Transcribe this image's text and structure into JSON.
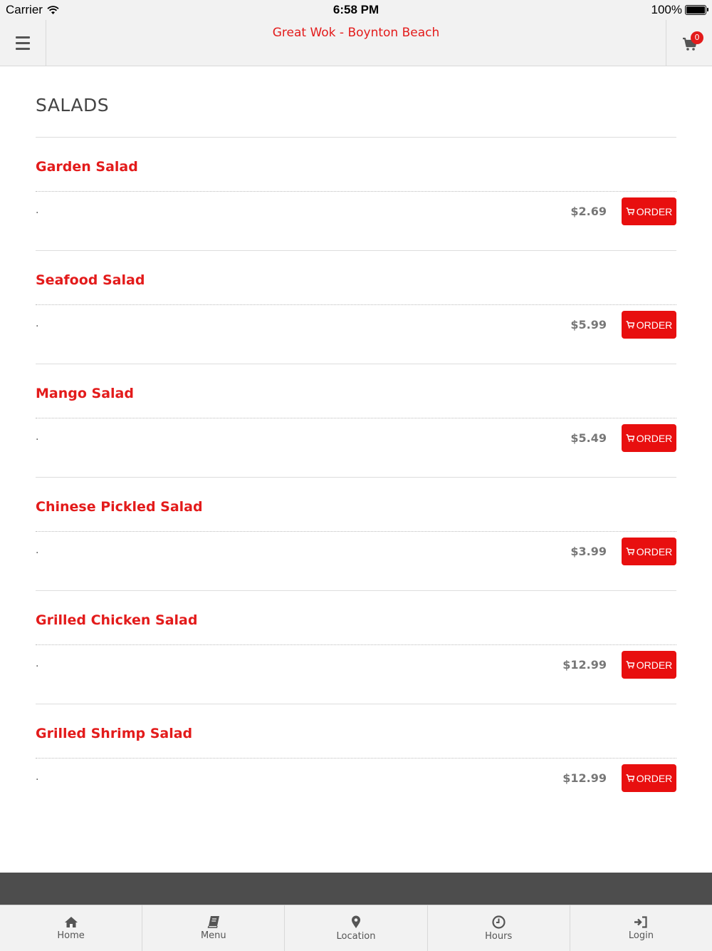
{
  "status_bar": {
    "carrier": "Carrier",
    "time": "6:58 PM",
    "battery": "100%"
  },
  "header": {
    "title": "Great Wok - Boynton Beach",
    "cart_count": "0"
  },
  "section": {
    "title": "SALADS"
  },
  "items": [
    {
      "name": "Garden Salad",
      "description": ".",
      "price": "$2.69",
      "order_label": "ORDER"
    },
    {
      "name": "Seafood Salad",
      "description": ".",
      "price": "$5.99",
      "order_label": "ORDER"
    },
    {
      "name": "Mango Salad",
      "description": ".",
      "price": "$5.49",
      "order_label": "ORDER"
    },
    {
      "name": "Chinese Pickled Salad",
      "description": ".",
      "price": "$3.99",
      "order_label": "ORDER"
    },
    {
      "name": "Grilled Chicken Salad",
      "description": ".",
      "price": "$12.99",
      "order_label": "ORDER"
    },
    {
      "name": "Grilled Shrimp Salad",
      "description": ".",
      "price": "$12.99",
      "order_label": "ORDER"
    }
  ],
  "tabs": [
    {
      "label": "Home",
      "icon": "home-icon"
    },
    {
      "label": "Menu",
      "icon": "book-icon"
    },
    {
      "label": "Location",
      "icon": "map-pin-icon"
    },
    {
      "label": "Hours",
      "icon": "clock-icon"
    },
    {
      "label": "Login",
      "icon": "sign-in-icon"
    }
  ],
  "colors": {
    "accent": "#e31b1b",
    "button": "#e80f0f",
    "footer": "#4d4d4d",
    "bar_bg": "#f2f2f2"
  }
}
